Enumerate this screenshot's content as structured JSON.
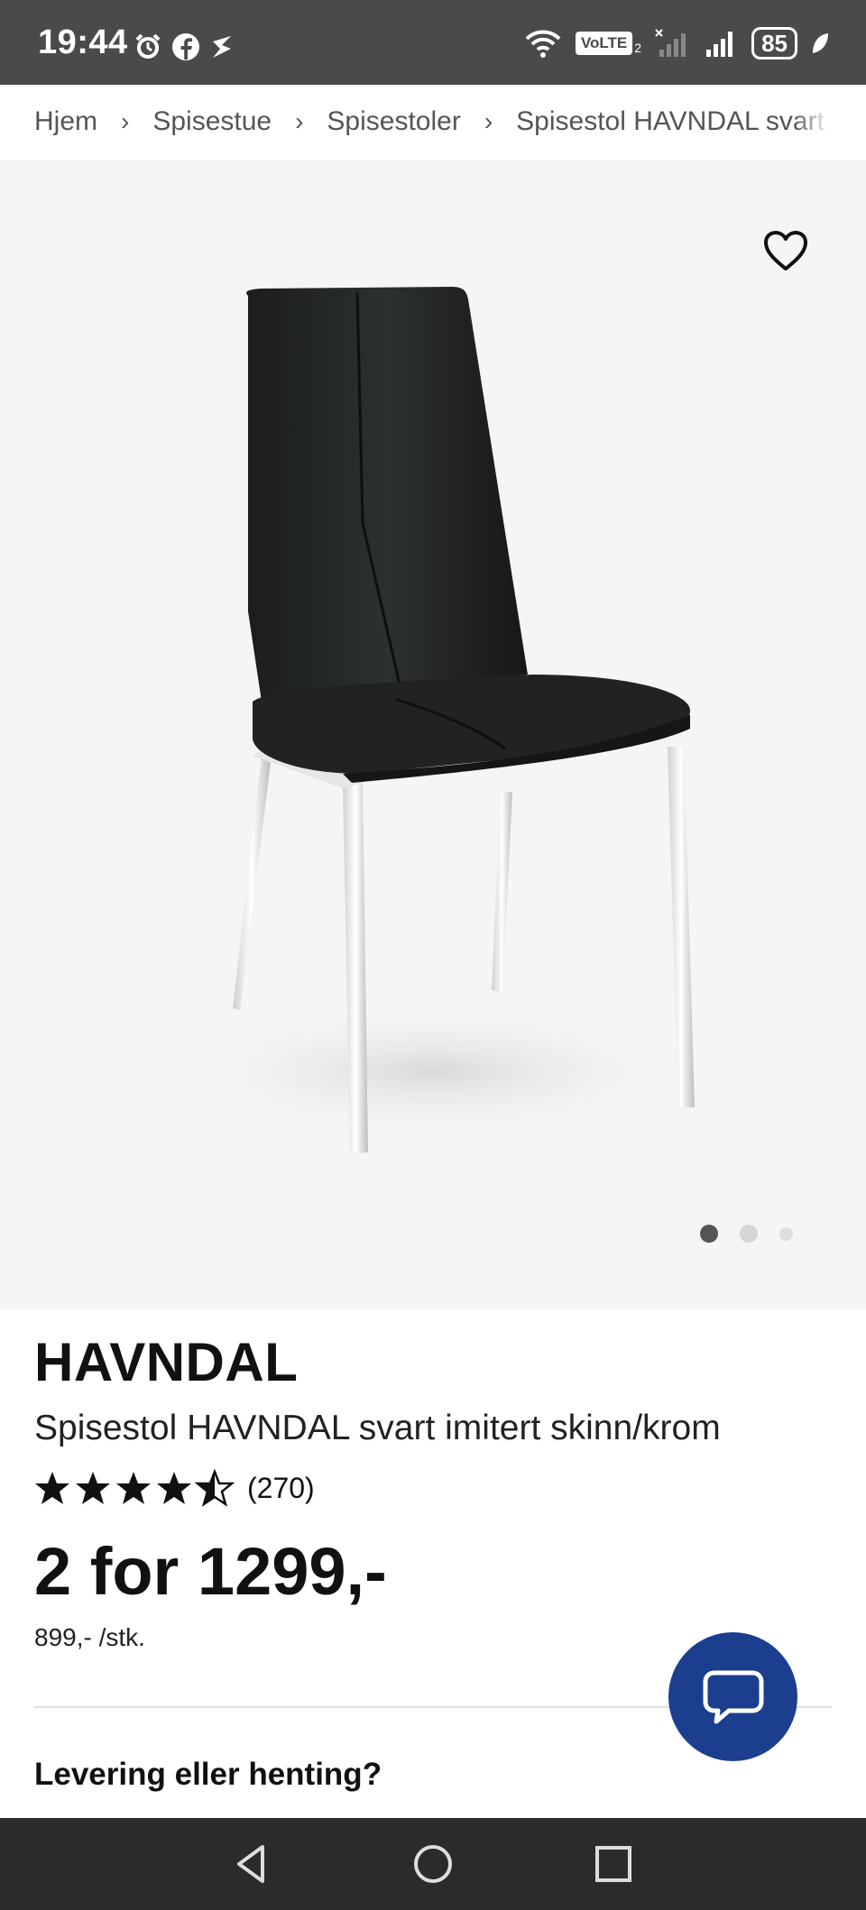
{
  "status_bar": {
    "time": "19:44",
    "left_icons": [
      "alarm-icon",
      "facebook-icon",
      "app-icon"
    ],
    "right_icons": [
      "wifi-icon",
      "volte-icon",
      "signal-sim2-icon",
      "signal-sim1-icon",
      "battery-icon",
      "leaf-icon"
    ],
    "volte_label": "VoLTE",
    "volte_sim": "2",
    "battery": "85"
  },
  "breadcrumb": {
    "items": [
      "Hjem",
      "Spisestue",
      "Spisestoler",
      "Spisestol HAVNDAL svart"
    ],
    "separator": "›"
  },
  "gallery": {
    "favorite_icon": "heart-outline-icon",
    "image_alt": "chair-product-image",
    "dots": 3,
    "active_dot": 0
  },
  "product": {
    "brand": "HAVNDAL",
    "subtitle": "Spisestol HAVNDAL svart imitert skinn/krom",
    "rating": 4.5,
    "rating_count": "(270)",
    "price": "2 for 1299,-",
    "unit_price": "899,- /stk.",
    "delivery_heading": "Levering eller henting?"
  },
  "chat": {
    "icon": "chat-bubble-icon"
  },
  "nav_bar": {
    "buttons": [
      "back-icon",
      "home-icon",
      "recents-icon"
    ]
  },
  "colors": {
    "accent": "#1b3e8f",
    "status_bar": "#4a4a4a",
    "nav_bar": "#2b2b2b",
    "gallery_bg": "#f5f5f5"
  }
}
